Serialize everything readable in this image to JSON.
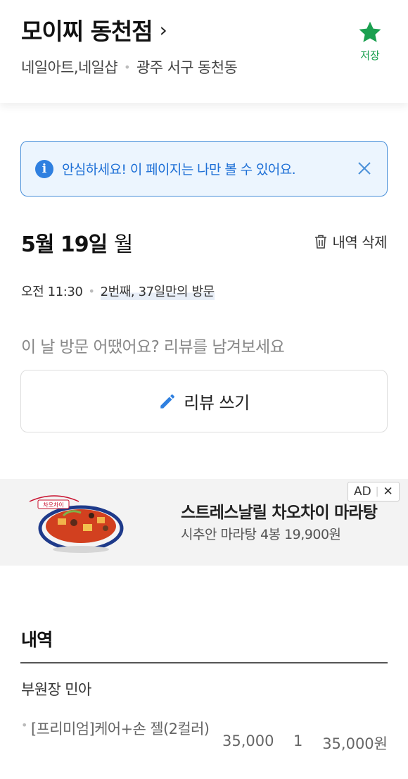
{
  "header": {
    "store_name": "모이찌 동천점",
    "chevron": "›",
    "category": "네일아트,네일샵",
    "location": "광주 서구 동천동",
    "save_label": "저장",
    "save_icon": "star-icon",
    "save_color": "#1ba050"
  },
  "notice": {
    "icon": "i",
    "text": "안심하세요! 이 페이지는 나만 볼 수 있어요."
  },
  "visit": {
    "date": "5월 19일",
    "day_of_week": "월",
    "delete_label": "내역 삭제",
    "time": "오전 11:30",
    "count_text": "2번째, 37일만의 방문"
  },
  "review": {
    "prompt": "이 날 방문 어땠어요? 리뷰를 남겨보세요",
    "button_label": "리뷰 쓰기"
  },
  "ad": {
    "title": "스트레스날릴 차오차이 마라탕",
    "description": "시추안 마라탕 4봉 19,900원",
    "badge": "AD",
    "close": "✕",
    "brand_mark": "차오차이"
  },
  "details": {
    "section_title": "내역",
    "staff": "부원장 민아",
    "items": [
      {
        "name": "[프리미엄]케어+손 젤(2컬러)",
        "price": "35,000",
        "qty": "1",
        "total": "35,000원"
      }
    ]
  },
  "colors": {
    "accent_green": "#1ba050",
    "notice_blue": "#1d6fd6",
    "notice_bg": "#ecf5fe"
  }
}
